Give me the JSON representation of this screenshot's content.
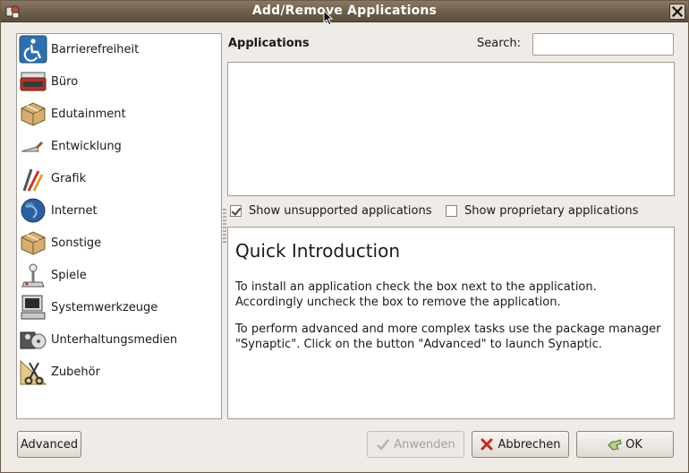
{
  "window": {
    "title": "Add/Remove Applications",
    "title_icon": "app-menu-icon",
    "close_icon": "close-icon"
  },
  "sidebar": {
    "items": [
      {
        "label": "Barrierefreiheit",
        "icon": "accessibility-icon"
      },
      {
        "label": "Büro",
        "icon": "typewriter-icon"
      },
      {
        "label": "Edutainment",
        "icon": "package-box-icon"
      },
      {
        "label": "Entwicklung",
        "icon": "trowel-icon"
      },
      {
        "label": "Grafik",
        "icon": "brushes-icon"
      },
      {
        "label": "Internet",
        "icon": "globe-icon"
      },
      {
        "label": "Sonstige",
        "icon": "package-box-icon"
      },
      {
        "label": "Spiele",
        "icon": "joystick-icon"
      },
      {
        "label": "Systemwerkzeuge",
        "icon": "computer-icon"
      },
      {
        "label": "Unterhaltungsmedien",
        "icon": "media-icon"
      },
      {
        "label": "Zubehör",
        "icon": "scissors-icon"
      }
    ]
  },
  "main": {
    "applications_label": "Applications",
    "search_label": "Search:",
    "search_value": "",
    "show_unsupported": {
      "label": "Show unsupported applications",
      "checked": true
    },
    "show_proprietary": {
      "label": "Show proprietary applications",
      "checked": false
    },
    "intro": {
      "heading": "Quick Introduction",
      "p1": "To install an application check the box next to the application. Accordingly uncheck the box to remove the application.",
      "p2": "To perform advanced and more complex tasks use the package manager \"Synaptic\". Click on the button \"Advanced\" to launch Synaptic."
    }
  },
  "buttons": {
    "advanced": "Advanced",
    "apply": "Anwenden",
    "cancel": "Abbrechen",
    "ok": "OK"
  },
  "colors": {
    "titlebar": "#6f5d4b",
    "panel_border": "#a39a8f",
    "window_bg": "#efebe7"
  }
}
